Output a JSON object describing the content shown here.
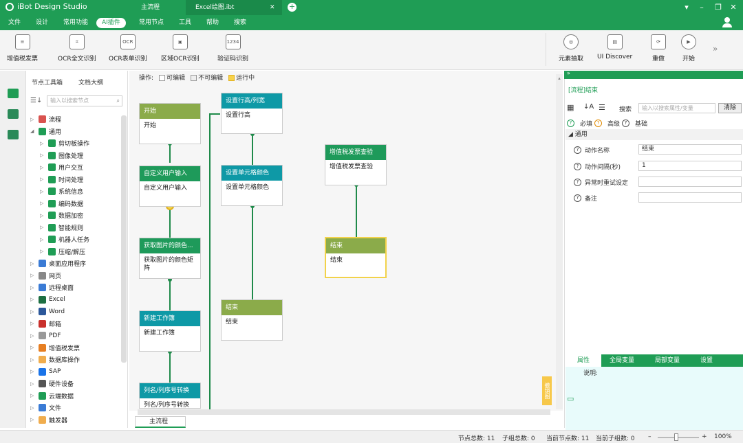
{
  "app": {
    "title": "iBot Design Studio"
  },
  "tabs": [
    {
      "label": "主流程"
    },
    {
      "label": "Excel绘图.ibt"
    }
  ],
  "menu": [
    "文件",
    "设计",
    "常用功能",
    "AI插件",
    "常用节点",
    "工具",
    "帮助",
    "搜索"
  ],
  "ribbon": {
    "left": [
      {
        "label": "增值税发票",
        "icon": "invoice-icon"
      },
      {
        "label": "OCR全文识别",
        "icon": "ocr-full-icon"
      },
      {
        "label": "OCR表单识别",
        "icon": "ocr-form-icon"
      },
      {
        "label": "区域OCR识别",
        "icon": "ocr-region-icon"
      },
      {
        "label": "验证码识别",
        "icon": "captcha-icon"
      }
    ],
    "right": [
      {
        "label": "元素抽取",
        "icon": "element-extract-icon"
      },
      {
        "label": "UI Discover",
        "icon": "ui-discover-icon"
      },
      {
        "label": "重做",
        "icon": "redo-icon"
      },
      {
        "label": "开始",
        "icon": "play-icon"
      }
    ],
    "captcha_text": "1234",
    "ocr_text": "OCR"
  },
  "left_panel": {
    "tabs": [
      "节点工具箱",
      "文档大纲"
    ],
    "search_placeholder": "输入以搜索节点",
    "tree": [
      {
        "label": "流程",
        "level": 0,
        "expanded": false,
        "color": "#d9534f"
      },
      {
        "label": "通用",
        "level": 0,
        "expanded": true,
        "color": "#1f9d55"
      },
      {
        "label": "剪切板操作",
        "level": 1,
        "color": "#1f9d55"
      },
      {
        "label": "图像处理",
        "level": 1,
        "color": "#1f9d55"
      },
      {
        "label": "用户交互",
        "level": 1,
        "color": "#1f9d55"
      },
      {
        "label": "时间处理",
        "level": 1,
        "color": "#1f9d55"
      },
      {
        "label": "系统信息",
        "level": 1,
        "color": "#1f9d55"
      },
      {
        "label": "编码数据",
        "level": 1,
        "color": "#1f9d55"
      },
      {
        "label": "数据加密",
        "level": 1,
        "color": "#1f9d55"
      },
      {
        "label": "智能规则",
        "level": 1,
        "color": "#1f9d55"
      },
      {
        "label": "机器人任务",
        "level": 1,
        "color": "#1f9d55"
      },
      {
        "label": "压缩/解压",
        "level": 1,
        "color": "#1f9d55"
      },
      {
        "label": "桌面应用程序",
        "level": 0,
        "expanded": false,
        "color": "#3a7bd5"
      },
      {
        "label": "网页",
        "level": 0,
        "expanded": false,
        "color": "#888888"
      },
      {
        "label": "远程桌面",
        "level": 0,
        "expanded": false,
        "color": "#3a7bd5"
      },
      {
        "label": "Excel",
        "level": 0,
        "expanded": false,
        "color": "#1d6f42"
      },
      {
        "label": "Word",
        "level": 0,
        "expanded": false,
        "color": "#2b579a"
      },
      {
        "label": "邮箱",
        "level": 0,
        "expanded": false,
        "color": "#c9302c"
      },
      {
        "label": "PDF",
        "level": 0,
        "expanded": false,
        "color": "#999999"
      },
      {
        "label": "增值税发票",
        "level": 0,
        "expanded": false,
        "color": "#e67e22"
      },
      {
        "label": "数据库操作",
        "level": 0,
        "expanded": false,
        "color": "#f0ad4e"
      },
      {
        "label": "SAP",
        "level": 0,
        "expanded": false,
        "color": "#1a73e8"
      },
      {
        "label": "硬件设备",
        "level": 0,
        "expanded": false,
        "color": "#555555"
      },
      {
        "label": "云端数据",
        "level": 0,
        "expanded": false,
        "color": "#1f9d55"
      },
      {
        "label": "文件",
        "level": 0,
        "expanded": false,
        "color": "#3a7bd5"
      },
      {
        "label": "触发器",
        "level": 0,
        "expanded": false,
        "color": "#f0ad4e"
      }
    ]
  },
  "canvas": {
    "legend": {
      "prefix": "操作:",
      "items": [
        "可编辑",
        "不可编辑",
        "运行中"
      ]
    },
    "nodes": [
      {
        "title": "开始",
        "body": "开始"
      },
      {
        "title": "自定义用户输入",
        "body": "自定义用户输入"
      },
      {
        "title": "获取图片的颜色...",
        "body": "获取图片的颜色矩阵"
      },
      {
        "title": "新建工作簿",
        "body": "新建工作簿"
      },
      {
        "title": "列名/列序号转换",
        "body": "列名/列序号转换"
      },
      {
        "title": "设置行高/列宽",
        "body": "设置行高"
      },
      {
        "title": "设置单元格颜色",
        "body": "设置单元格颜色"
      },
      {
        "title": "结束",
        "body": "结束"
      },
      {
        "title": "增值税发票查验",
        "body": "增值税发票查验"
      },
      {
        "title": "结束",
        "body": "结束"
      }
    ],
    "side_tab": "撤销图",
    "bottom_tab": "主流程"
  },
  "right_panel": {
    "title": "[流程]结束",
    "search_label": "搜索",
    "search_placeholder": "输入以搜索属性/变量",
    "clear_button": "清除",
    "filters": [
      "必填",
      "高级",
      "基础"
    ],
    "section": "通用",
    "props": [
      {
        "label": "动作名称",
        "value": "结束"
      },
      {
        "label": "动作间隔(秒)",
        "value": "1"
      },
      {
        "label": "异常时重试设定",
        "value": ""
      },
      {
        "label": "备注",
        "value": ""
      }
    ],
    "bottom_tabs": [
      "属性",
      "全局变量",
      "局部变量",
      "设置"
    ],
    "desc_label": "说明:"
  },
  "status": {
    "node_total": "节点总数: 11",
    "child_total": "子组总数: 0",
    "current_nodes": "当前节点数: 11",
    "current_groups": "当前子组数: 0",
    "zoom": "100%"
  }
}
